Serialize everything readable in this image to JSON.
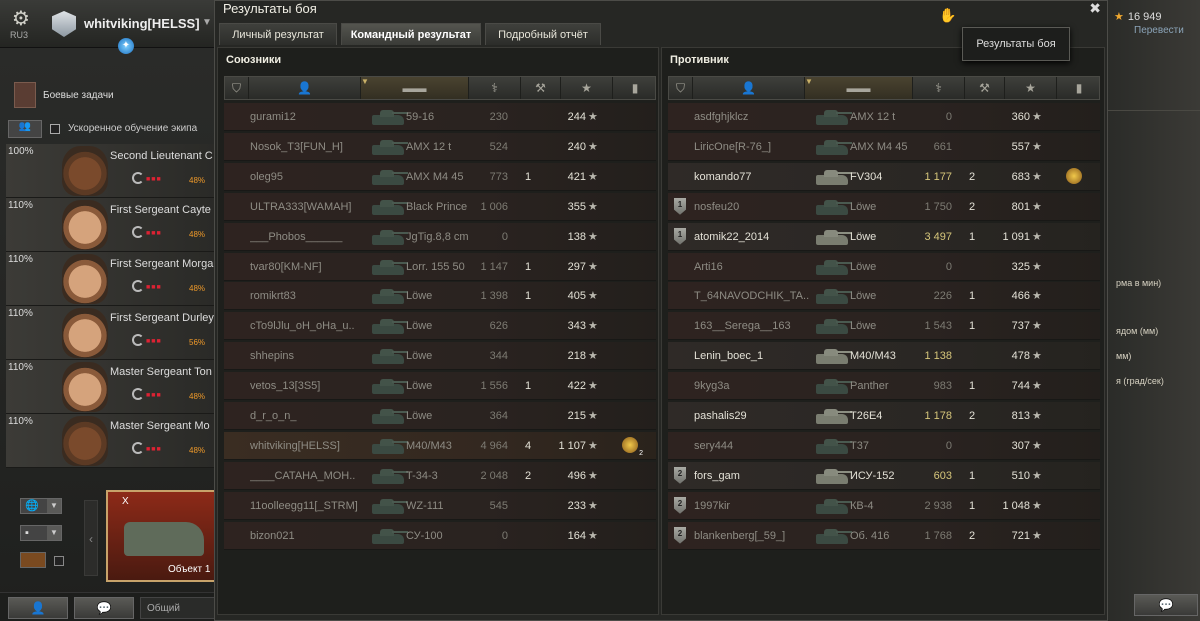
{
  "hangar": {
    "server": "RU3",
    "player_name": "whitviking[HELSS]",
    "missions_label": "Боевые задачи",
    "accelerated_crew_label": "Ускоренное обучение экипа",
    "gold": "16 949",
    "transfer_label": "Перевести",
    "tank_card_name": "Объект 1",
    "tank_card_badge": "X",
    "chat_channel": "Общий",
    "right_texts": [
      "рма в мин)",
      "ядом (мм)",
      "мм)",
      "я (град/сек)"
    ],
    "crew": [
      {
        "pct": "100%",
        "name": "Second Lieutenant C",
        "skill_pct": "48%",
        "dark": true
      },
      {
        "pct": "110%",
        "name": "First Sergeant Cayte",
        "skill_pct": "48%",
        "dark": false
      },
      {
        "pct": "110%",
        "name": "First Sergeant Morga",
        "skill_pct": "48%",
        "dark": false
      },
      {
        "pct": "110%",
        "name": "First Sergeant Durley",
        "skill_pct": "56%",
        "dark": false
      },
      {
        "pct": "110%",
        "name": "Master Sergeant Ton",
        "skill_pct": "48%",
        "dark": false
      },
      {
        "pct": "110%",
        "name": "Master Sergeant Mo",
        "skill_pct": "48%",
        "dark": true
      }
    ]
  },
  "window": {
    "title": "Результаты боя",
    "tooltip": "Результаты боя",
    "tabs": [
      {
        "label": "Личный результат",
        "active": false
      },
      {
        "label": "Командный результат",
        "active": true
      },
      {
        "label": "Подробный отчёт",
        "active": false
      }
    ],
    "allies_title": "Союзники",
    "enemies_title": "Противник"
  },
  "allies": [
    {
      "name": "gurami12",
      "tank": "59-16",
      "dmg": "230",
      "kills": "",
      "xp": "244",
      "alive": false
    },
    {
      "name": "Nosok_T3[FUN_H]",
      "tank": "AMX 12 t",
      "dmg": "524",
      "kills": "",
      "xp": "240",
      "alive": false
    },
    {
      "name": "oleg95",
      "tank": "AMX M4 45",
      "dmg": "773",
      "kills": "1",
      "xp": "421",
      "alive": false
    },
    {
      "name": "ULTRA333[WAMAH]",
      "tank": "Black Prince",
      "dmg": "1 006",
      "kills": "",
      "xp": "355",
      "alive": false
    },
    {
      "name": "___Phobos______",
      "tank": "JgTig.8,8 cm",
      "dmg": "0",
      "kills": "",
      "xp": "138",
      "alive": false
    },
    {
      "name": "tvar80[KM-NF]",
      "tank": "Lorr. 155 50",
      "dmg": "1 147",
      "kills": "1",
      "xp": "297",
      "alive": false
    },
    {
      "name": "romikrt83",
      "tank": "Löwe",
      "dmg": "1 398",
      "kills": "1",
      "xp": "405",
      "alive": false
    },
    {
      "name": "cTo9lJlu_oH_oHa_u..",
      "tank": "Löwe",
      "dmg": "626",
      "kills": "",
      "xp": "343",
      "alive": false
    },
    {
      "name": "shhepins",
      "tank": "Löwe",
      "dmg": "344",
      "kills": "",
      "xp": "218",
      "alive": false
    },
    {
      "name": "vetos_13[3S5]",
      "tank": "Löwe",
      "dmg": "1 556",
      "kills": "1",
      "xp": "422",
      "alive": false
    },
    {
      "name": "d_r_o_n_",
      "tank": "Löwe",
      "dmg": "364",
      "kills": "",
      "xp": "215",
      "alive": false
    },
    {
      "name": "whitviking[HELSS]",
      "tank": "M40/M43",
      "dmg": "4 964",
      "kills": "4",
      "xp": "1 107",
      "alive": false,
      "me": true,
      "medal": "2"
    },
    {
      "name": "____CATAHA_MOH..",
      "tank": "T-34-3",
      "dmg": "2 048",
      "kills": "2",
      "xp": "496",
      "alive": false
    },
    {
      "name": "11oolleegg11[_STRM]",
      "tank": "WZ-111",
      "dmg": "545",
      "kills": "",
      "xp": "233",
      "alive": false
    },
    {
      "name": "bizon021",
      "tank": "СУ-100",
      "dmg": "0",
      "kills": "",
      "xp": "164",
      "alive": false
    }
  ],
  "enemies": [
    {
      "name": "asdfghjklcz",
      "tank": "AMX 12 t",
      "dmg": "0",
      "kills": "",
      "xp": "360",
      "alive": false
    },
    {
      "name": "LiricOne[R-76_]",
      "tank": "AMX M4 45",
      "dmg": "661",
      "kills": "",
      "xp": "557",
      "alive": false
    },
    {
      "name": "komando77",
      "tank": "FV304",
      "dmg": "1 177",
      "kills": "2",
      "xp": "683",
      "alive": true,
      "medal": ""
    },
    {
      "name": "nosfeu20",
      "tank": "Löwe",
      "dmg": "1 750",
      "kills": "2",
      "xp": "801",
      "alive": false,
      "squad": "1"
    },
    {
      "name": "atomik22_2014",
      "tank": "Löwe",
      "dmg": "3 497",
      "kills": "1",
      "xp": "1 091",
      "alive": true,
      "squad": "1"
    },
    {
      "name": "Arti16",
      "tank": "Löwe",
      "dmg": "0",
      "kills": "",
      "xp": "325",
      "alive": false
    },
    {
      "name": "T_64NAVODCHIK_TA..",
      "tank": "Löwe",
      "dmg": "226",
      "kills": "1",
      "xp": "466",
      "alive": false
    },
    {
      "name": "163__Serega__163",
      "tank": "Löwe",
      "dmg": "1 543",
      "kills": "1",
      "xp": "737",
      "alive": false
    },
    {
      "name": "Lenin_boec_1",
      "tank": "M40/M43",
      "dmg": "1 138",
      "kills": "",
      "xp": "478",
      "alive": true
    },
    {
      "name": "9kyg3a",
      "tank": "Panther",
      "dmg": "983",
      "kills": "1",
      "xp": "744",
      "alive": false
    },
    {
      "name": "pashalis29",
      "tank": "T26E4",
      "dmg": "1 178",
      "kills": "2",
      "xp": "813",
      "alive": true
    },
    {
      "name": "sery444",
      "tank": "T37",
      "dmg": "0",
      "kills": "",
      "xp": "307",
      "alive": false
    },
    {
      "name": "fors_gam",
      "tank": "ИСУ-152",
      "dmg": "603",
      "kills": "1",
      "xp": "510",
      "alive": true,
      "squad": "2"
    },
    {
      "name": "1997kir",
      "tank": "КВ-4",
      "dmg": "2 938",
      "kills": "1",
      "xp": "1 048",
      "alive": false,
      "squad": "2"
    },
    {
      "name": "blankenberg[_59_]",
      "tank": "Об. 416",
      "dmg": "1 768",
      "kills": "2",
      "xp": "721",
      "alive": false,
      "squad": "2"
    }
  ]
}
